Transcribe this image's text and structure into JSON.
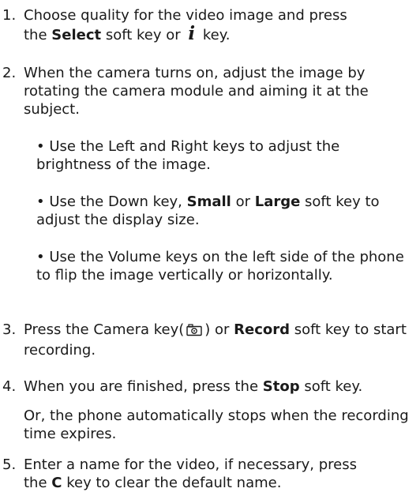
{
  "steps": [
    {
      "number": "1.",
      "line1": "Choose quality for the video image and press",
      "line2_pre": "the ",
      "select_key": "Select",
      "line2_mid": " soft key or ",
      "info_key_glyph": "i",
      "line2_post": " key."
    },
    {
      "number": "2.",
      "text": "When the camera turns on, adjust the image by rotating the camera module and aiming it at the subject.",
      "bullets": [
        {
          "text": "• Use the Left and Right keys to adjust the brightness of the image."
        },
        {
          "pre": "• Use the Down key, ",
          "bold1": "Small",
          "mid": " or ",
          "bold2": "Large",
          "post": " soft key to adjust the display size."
        },
        {
          "text": "• Use the Volume keys on the left side of the phone to flip the image vertically or horizontally."
        }
      ]
    },
    {
      "number": "3.",
      "pre": "Press the Camera key(",
      "camera_icon": "camera-key-icon",
      "mid": ") or ",
      "bold": "Record",
      "post": " soft key to start recording."
    },
    {
      "number": "4.",
      "pre": "When you are finished, press the ",
      "bold": "Stop",
      "post": " soft key.",
      "note": "Or, the phone automatically stops when the recording time expires."
    },
    {
      "number": "5.",
      "line1": "Enter a name for the video, if necessary, press",
      "line2_pre": "the ",
      "bold": "C",
      "line2_post": " key to clear the default name."
    }
  ]
}
